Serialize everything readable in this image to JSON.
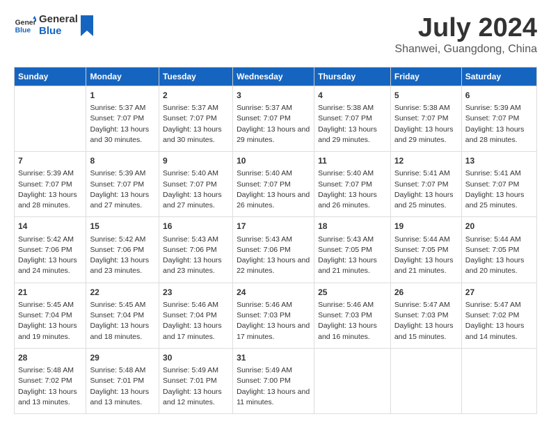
{
  "header": {
    "logo_general": "General",
    "logo_blue": "Blue",
    "month": "July 2024",
    "location": "Shanwei, Guangdong, China"
  },
  "columns": [
    "Sunday",
    "Monday",
    "Tuesday",
    "Wednesday",
    "Thursday",
    "Friday",
    "Saturday"
  ],
  "weeks": [
    [
      {
        "day": "",
        "sunrise": "",
        "sunset": "",
        "daylight": ""
      },
      {
        "day": "1",
        "sunrise": "Sunrise: 5:37 AM",
        "sunset": "Sunset: 7:07 PM",
        "daylight": "Daylight: 13 hours and 30 minutes."
      },
      {
        "day": "2",
        "sunrise": "Sunrise: 5:37 AM",
        "sunset": "Sunset: 7:07 PM",
        "daylight": "Daylight: 13 hours and 30 minutes."
      },
      {
        "day": "3",
        "sunrise": "Sunrise: 5:37 AM",
        "sunset": "Sunset: 7:07 PM",
        "daylight": "Daylight: 13 hours and 29 minutes."
      },
      {
        "day": "4",
        "sunrise": "Sunrise: 5:38 AM",
        "sunset": "Sunset: 7:07 PM",
        "daylight": "Daylight: 13 hours and 29 minutes."
      },
      {
        "day": "5",
        "sunrise": "Sunrise: 5:38 AM",
        "sunset": "Sunset: 7:07 PM",
        "daylight": "Daylight: 13 hours and 29 minutes."
      },
      {
        "day": "6",
        "sunrise": "Sunrise: 5:39 AM",
        "sunset": "Sunset: 7:07 PM",
        "daylight": "Daylight: 13 hours and 28 minutes."
      }
    ],
    [
      {
        "day": "7",
        "sunrise": "Sunrise: 5:39 AM",
        "sunset": "Sunset: 7:07 PM",
        "daylight": "Daylight: 13 hours and 28 minutes."
      },
      {
        "day": "8",
        "sunrise": "Sunrise: 5:39 AM",
        "sunset": "Sunset: 7:07 PM",
        "daylight": "Daylight: 13 hours and 27 minutes."
      },
      {
        "day": "9",
        "sunrise": "Sunrise: 5:40 AM",
        "sunset": "Sunset: 7:07 PM",
        "daylight": "Daylight: 13 hours and 27 minutes."
      },
      {
        "day": "10",
        "sunrise": "Sunrise: 5:40 AM",
        "sunset": "Sunset: 7:07 PM",
        "daylight": "Daylight: 13 hours and 26 minutes."
      },
      {
        "day": "11",
        "sunrise": "Sunrise: 5:40 AM",
        "sunset": "Sunset: 7:07 PM",
        "daylight": "Daylight: 13 hours and 26 minutes."
      },
      {
        "day": "12",
        "sunrise": "Sunrise: 5:41 AM",
        "sunset": "Sunset: 7:07 PM",
        "daylight": "Daylight: 13 hours and 25 minutes."
      },
      {
        "day": "13",
        "sunrise": "Sunrise: 5:41 AM",
        "sunset": "Sunset: 7:07 PM",
        "daylight": "Daylight: 13 hours and 25 minutes."
      }
    ],
    [
      {
        "day": "14",
        "sunrise": "Sunrise: 5:42 AM",
        "sunset": "Sunset: 7:06 PM",
        "daylight": "Daylight: 13 hours and 24 minutes."
      },
      {
        "day": "15",
        "sunrise": "Sunrise: 5:42 AM",
        "sunset": "Sunset: 7:06 PM",
        "daylight": "Daylight: 13 hours and 23 minutes."
      },
      {
        "day": "16",
        "sunrise": "Sunrise: 5:43 AM",
        "sunset": "Sunset: 7:06 PM",
        "daylight": "Daylight: 13 hours and 23 minutes."
      },
      {
        "day": "17",
        "sunrise": "Sunrise: 5:43 AM",
        "sunset": "Sunset: 7:06 PM",
        "daylight": "Daylight: 13 hours and 22 minutes."
      },
      {
        "day": "18",
        "sunrise": "Sunrise: 5:43 AM",
        "sunset": "Sunset: 7:05 PM",
        "daylight": "Daylight: 13 hours and 21 minutes."
      },
      {
        "day": "19",
        "sunrise": "Sunrise: 5:44 AM",
        "sunset": "Sunset: 7:05 PM",
        "daylight": "Daylight: 13 hours and 21 minutes."
      },
      {
        "day": "20",
        "sunrise": "Sunrise: 5:44 AM",
        "sunset": "Sunset: 7:05 PM",
        "daylight": "Daylight: 13 hours and 20 minutes."
      }
    ],
    [
      {
        "day": "21",
        "sunrise": "Sunrise: 5:45 AM",
        "sunset": "Sunset: 7:04 PM",
        "daylight": "Daylight: 13 hours and 19 minutes."
      },
      {
        "day": "22",
        "sunrise": "Sunrise: 5:45 AM",
        "sunset": "Sunset: 7:04 PM",
        "daylight": "Daylight: 13 hours and 18 minutes."
      },
      {
        "day": "23",
        "sunrise": "Sunrise: 5:46 AM",
        "sunset": "Sunset: 7:04 PM",
        "daylight": "Daylight: 13 hours and 17 minutes."
      },
      {
        "day": "24",
        "sunrise": "Sunrise: 5:46 AM",
        "sunset": "Sunset: 7:03 PM",
        "daylight": "Daylight: 13 hours and 17 minutes."
      },
      {
        "day": "25",
        "sunrise": "Sunrise: 5:46 AM",
        "sunset": "Sunset: 7:03 PM",
        "daylight": "Daylight: 13 hours and 16 minutes."
      },
      {
        "day": "26",
        "sunrise": "Sunrise: 5:47 AM",
        "sunset": "Sunset: 7:03 PM",
        "daylight": "Daylight: 13 hours and 15 minutes."
      },
      {
        "day": "27",
        "sunrise": "Sunrise: 5:47 AM",
        "sunset": "Sunset: 7:02 PM",
        "daylight": "Daylight: 13 hours and 14 minutes."
      }
    ],
    [
      {
        "day": "28",
        "sunrise": "Sunrise: 5:48 AM",
        "sunset": "Sunset: 7:02 PM",
        "daylight": "Daylight: 13 hours and 13 minutes."
      },
      {
        "day": "29",
        "sunrise": "Sunrise: 5:48 AM",
        "sunset": "Sunset: 7:01 PM",
        "daylight": "Daylight: 13 hours and 13 minutes."
      },
      {
        "day": "30",
        "sunrise": "Sunrise: 5:49 AM",
        "sunset": "Sunset: 7:01 PM",
        "daylight": "Daylight: 13 hours and 12 minutes."
      },
      {
        "day": "31",
        "sunrise": "Sunrise: 5:49 AM",
        "sunset": "Sunset: 7:00 PM",
        "daylight": "Daylight: 13 hours and 11 minutes."
      },
      {
        "day": "",
        "sunrise": "",
        "sunset": "",
        "daylight": ""
      },
      {
        "day": "",
        "sunrise": "",
        "sunset": "",
        "daylight": ""
      },
      {
        "day": "",
        "sunrise": "",
        "sunset": "",
        "daylight": ""
      }
    ]
  ]
}
